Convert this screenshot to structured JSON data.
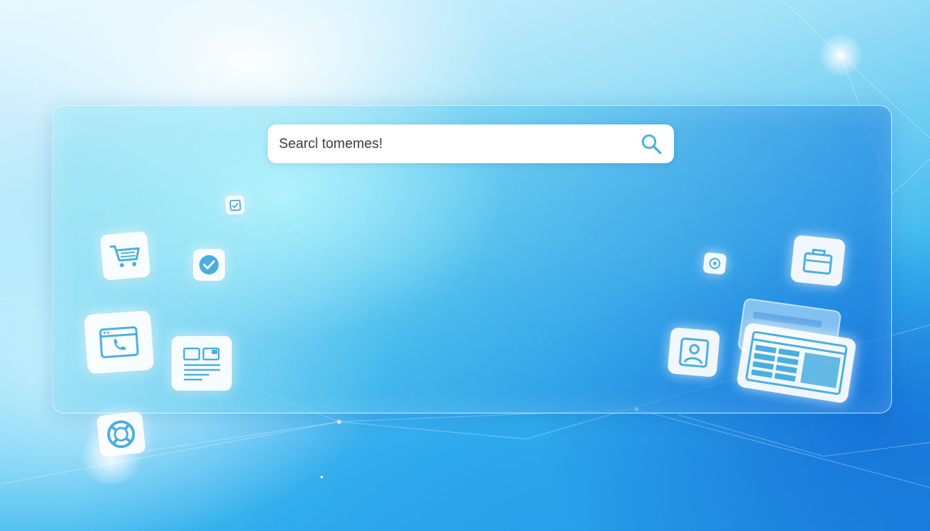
{
  "search": {
    "text": "Searcl tomemes!",
    "icon": "search-icon"
  },
  "icons": {
    "cart": "shopping-cart-icon",
    "check_small": "checkbox-check-icon",
    "check_circle": "check-circle-icon",
    "browser_phone": "browser-window-icon",
    "layout": "layout-grid-icon",
    "lifebuoy": "lifebuoy-icon",
    "badge": "badge-icon",
    "briefcase": "briefcase-icon",
    "user_profile": "user-profile-icon",
    "spreadsheet": "spreadsheet-window-icon"
  },
  "colors": {
    "accent": "#4aaee0",
    "panel_border": "#ffffff",
    "search_text": "#3a3f45"
  }
}
